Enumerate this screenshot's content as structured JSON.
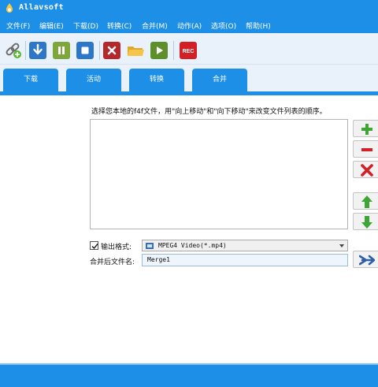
{
  "window": {
    "title": "Allavsoft",
    "accent_color": "#1e8fe6"
  },
  "menu": {
    "items": [
      {
        "label": "文件(F)"
      },
      {
        "label": "编辑(E)"
      },
      {
        "label": "下载(D)"
      },
      {
        "label": "转换(C)"
      },
      {
        "label": "合并(M)"
      },
      {
        "label": "动作(A)"
      },
      {
        "label": "选项(O)"
      },
      {
        "label": "帮助(H)"
      }
    ]
  },
  "toolbar": {
    "buttons": [
      {
        "icon": "link-add-icon"
      },
      {
        "icon": "download-icon"
      },
      {
        "icon": "pause-icon"
      },
      {
        "icon": "stop-icon"
      },
      {
        "icon": "delete-icon"
      },
      {
        "icon": "folder-icon"
      },
      {
        "icon": "play-icon"
      },
      {
        "icon": "record-icon",
        "label": "REC"
      }
    ]
  },
  "tabs": [
    {
      "label": "下载"
    },
    {
      "label": "活动"
    },
    {
      "label": "转换"
    },
    {
      "label": "合并",
      "active": true
    }
  ],
  "merge": {
    "hint": "选择您本地的f4f文件，用\"向上移动\"和\"向下移动\"来改变文件列表的顺序。",
    "file_list": [],
    "side_buttons": [
      {
        "icon": "add-icon"
      },
      {
        "icon": "remove-icon"
      },
      {
        "icon": "clear-icon"
      },
      {
        "icon": "move-up-icon"
      },
      {
        "icon": "move-down-icon"
      }
    ],
    "output_format_checked": true,
    "output_format_label": "输出格式:",
    "output_format_value": "MPEG4 Video(*.mp4)",
    "merged_name_label": "合并后文件名:",
    "merged_name_value": "Merge1"
  }
}
